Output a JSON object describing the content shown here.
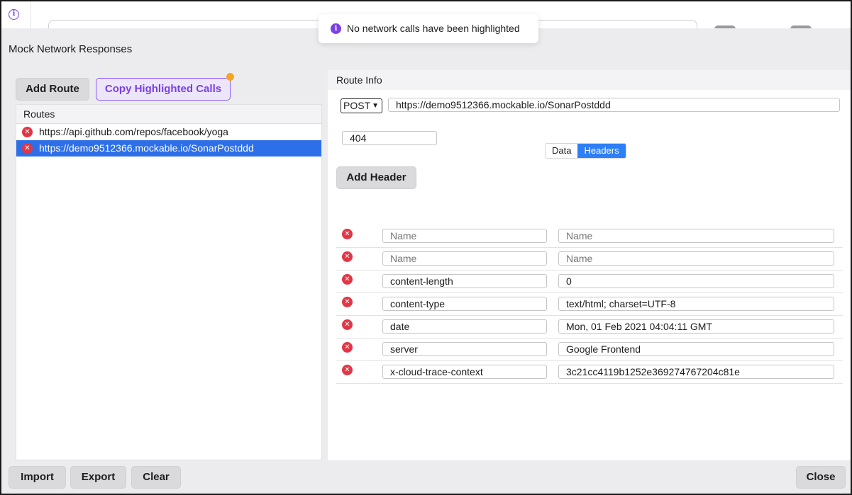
{
  "toast": {
    "message": "No network calls have been highlighted",
    "icon": "info-icon"
  },
  "modal": {
    "title": "Mock Network Responses"
  },
  "toolbar": {
    "add_route": "Add Route",
    "copy_highlighted": "Copy Highlighted Calls"
  },
  "routes": {
    "header": "Routes",
    "items": [
      {
        "url": "https://api.github.com/repos/facebook/yoga"
      },
      {
        "url": "https://demo9512366.mockable.io/SonarPostddd"
      }
    ]
  },
  "route_info": {
    "header": "Route Info",
    "method": "POST",
    "url": "https://demo9512366.mockable.io/SonarPostddd",
    "status": "404",
    "tabs": [
      "Data",
      "Headers"
    ],
    "active_tab": "Headers",
    "add_header": "Add Header",
    "headers": [
      {
        "name": "",
        "value": ""
      },
      {
        "name": "",
        "value": ""
      },
      {
        "name": "content-length",
        "value": "0"
      },
      {
        "name": "content-type",
        "value": "text/html; charset=UTF-8"
      },
      {
        "name": "date",
        "value": "Mon, 01 Feb 2021 04:04:11 GMT"
      },
      {
        "name": "server",
        "value": "Google Frontend"
      },
      {
        "name": "x-cloud-trace-context",
        "value": "3c21cc4119b1252e369274767204c81e"
      }
    ],
    "placeholder": "Name"
  },
  "footer": {
    "import": "Import",
    "export": "Export",
    "clear": "Clear",
    "close": "Close"
  },
  "colors": {
    "accent": "#7b3fe4",
    "selected": "#2d6fe8",
    "delete": "#e33545",
    "notification": "#f5a623"
  }
}
